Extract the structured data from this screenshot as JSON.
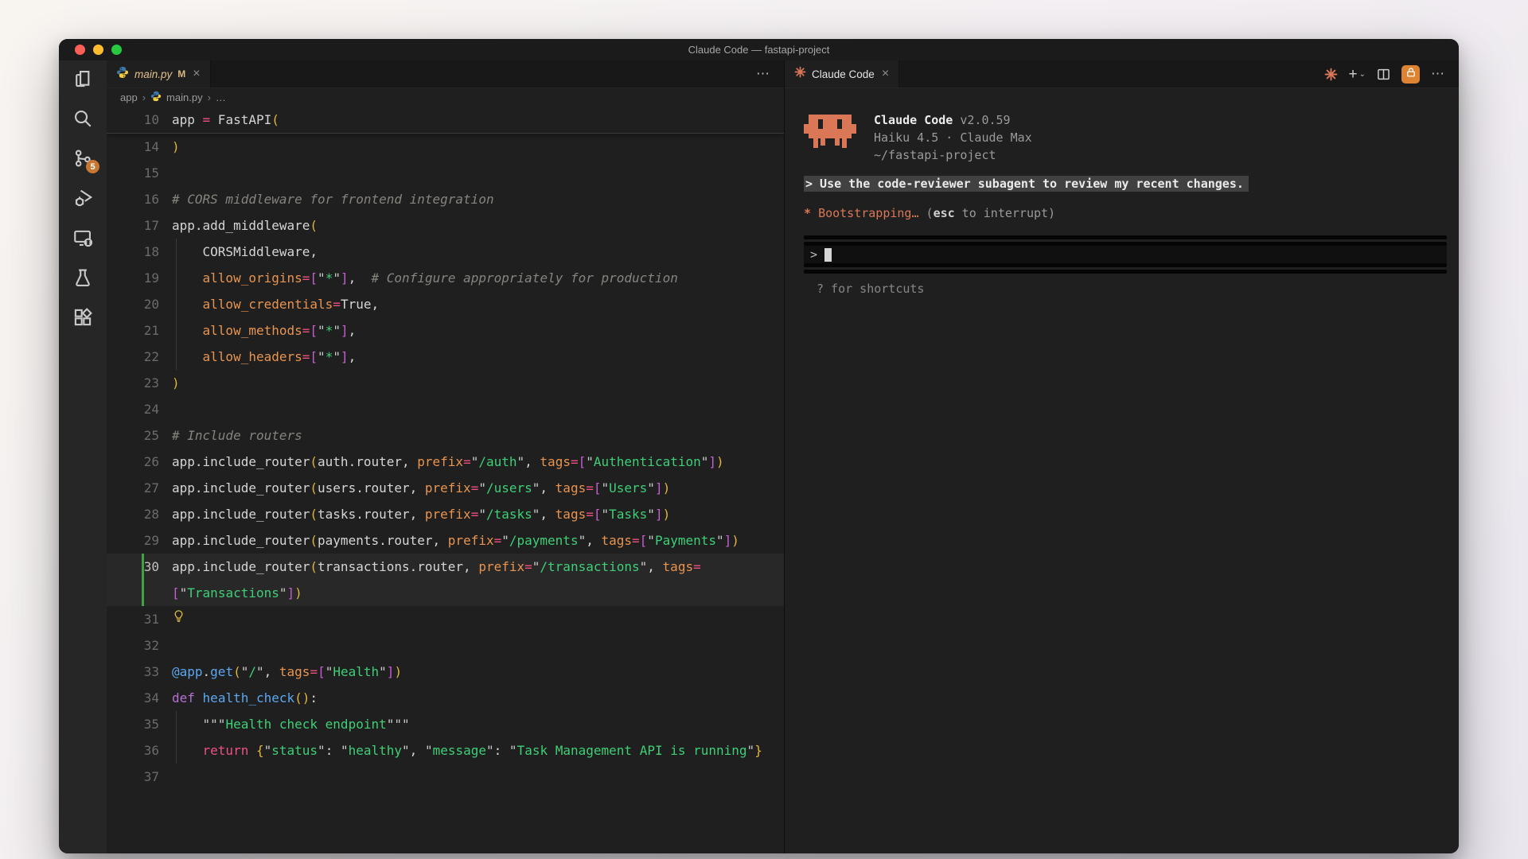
{
  "window": {
    "title": "Claude Code — fastapi-project"
  },
  "activity_bar": {
    "badge": "5",
    "items": [
      "explorer",
      "search",
      "source-control",
      "run-and-debug",
      "remote-explorer",
      "testing",
      "extensions"
    ]
  },
  "left_editor": {
    "tab": {
      "label": "main.py",
      "modified": "M",
      "close": "×"
    },
    "actions_icon": "⋯",
    "breadcrumb": {
      "items": [
        "app",
        "main.py",
        "…"
      ],
      "separator": "›"
    },
    "sticky": {
      "num": "10",
      "tokens": [
        [
          "app ",
          "p"
        ],
        [
          "=",
          "k"
        ],
        [
          " FastAPI",
          "p"
        ],
        [
          "(",
          "b1"
        ]
      ]
    },
    "lines": [
      {
        "num": "14",
        "tokens": [
          [
            ")",
            "b1"
          ]
        ]
      },
      {
        "num": "15",
        "tokens": []
      },
      {
        "num": "16",
        "tokens": [
          [
            "# CORS middleware for frontend integration",
            "c"
          ]
        ]
      },
      {
        "num": "17",
        "tokens": [
          [
            "app.add_middleware",
            "p"
          ],
          [
            "(",
            "b1"
          ]
        ]
      },
      {
        "num": "18",
        "flags": [
          "ig"
        ],
        "tokens": [
          [
            "    CORSMiddleware,",
            "p"
          ]
        ]
      },
      {
        "num": "19",
        "flags": [
          "ig"
        ],
        "tokens": [
          [
            "    ",
            "p"
          ],
          [
            "allow_origins",
            "prm"
          ],
          [
            "=",
            "k"
          ],
          [
            "[",
            "b2"
          ],
          [
            "\"",
            "q"
          ],
          [
            "*",
            "s"
          ],
          [
            "\"",
            "q"
          ],
          [
            "]",
            "b2"
          ],
          [
            ",",
            "p"
          ],
          [
            "  ",
            "p"
          ],
          [
            "# Configure appropriately for production",
            "c"
          ]
        ]
      },
      {
        "num": "20",
        "flags": [
          "ig"
        ],
        "tokens": [
          [
            "    ",
            "p"
          ],
          [
            "allow_credentials",
            "prm"
          ],
          [
            "=",
            "k"
          ],
          [
            "True,",
            "p"
          ]
        ]
      },
      {
        "num": "21",
        "flags": [
          "ig"
        ],
        "tokens": [
          [
            "    ",
            "p"
          ],
          [
            "allow_methods",
            "prm"
          ],
          [
            "=",
            "k"
          ],
          [
            "[",
            "b2"
          ],
          [
            "\"",
            "q"
          ],
          [
            "*",
            "s"
          ],
          [
            "\"",
            "q"
          ],
          [
            "]",
            "b2"
          ],
          [
            ",",
            "p"
          ]
        ]
      },
      {
        "num": "22",
        "flags": [
          "ig"
        ],
        "tokens": [
          [
            "    ",
            "p"
          ],
          [
            "allow_headers",
            "prm"
          ],
          [
            "=",
            "k"
          ],
          [
            "[",
            "b2"
          ],
          [
            "\"",
            "q"
          ],
          [
            "*",
            "s"
          ],
          [
            "\"",
            "q"
          ],
          [
            "]",
            "b2"
          ],
          [
            ",",
            "p"
          ]
        ]
      },
      {
        "num": "23",
        "tokens": [
          [
            ")",
            "b1"
          ]
        ]
      },
      {
        "num": "24",
        "tokens": []
      },
      {
        "num": "25",
        "tokens": [
          [
            "# Include routers",
            "c"
          ]
        ]
      },
      {
        "num": "26",
        "tokens": [
          [
            "app.include_router",
            "p"
          ],
          [
            "(",
            "b1"
          ],
          [
            "auth.router, ",
            "p"
          ],
          [
            "prefix",
            "prm"
          ],
          [
            "=",
            "k"
          ],
          [
            "\"",
            "q"
          ],
          [
            "/auth",
            "s"
          ],
          [
            "\"",
            "q"
          ],
          [
            ", ",
            "p"
          ],
          [
            "tags",
            "prm"
          ],
          [
            "=",
            "k"
          ],
          [
            "[",
            "b2"
          ],
          [
            "\"",
            "q"
          ],
          [
            "Authentication",
            "s"
          ],
          [
            "\"",
            "q"
          ],
          [
            "]",
            "b2"
          ],
          [
            ")",
            "b1"
          ]
        ]
      },
      {
        "num": "27",
        "tokens": [
          [
            "app.include_router",
            "p"
          ],
          [
            "(",
            "b1"
          ],
          [
            "users.router, ",
            "p"
          ],
          [
            "prefix",
            "prm"
          ],
          [
            "=",
            "k"
          ],
          [
            "\"",
            "q"
          ],
          [
            "/users",
            "s"
          ],
          [
            "\"",
            "q"
          ],
          [
            ", ",
            "p"
          ],
          [
            "tags",
            "prm"
          ],
          [
            "=",
            "k"
          ],
          [
            "[",
            "b2"
          ],
          [
            "\"",
            "q"
          ],
          [
            "Users",
            "s"
          ],
          [
            "\"",
            "q"
          ],
          [
            "]",
            "b2"
          ],
          [
            ")",
            "b1"
          ]
        ]
      },
      {
        "num": "28",
        "tokens": [
          [
            "app.include_router",
            "p"
          ],
          [
            "(",
            "b1"
          ],
          [
            "tasks.router, ",
            "p"
          ],
          [
            "prefix",
            "prm"
          ],
          [
            "=",
            "k"
          ],
          [
            "\"",
            "q"
          ],
          [
            "/tasks",
            "s"
          ],
          [
            "\"",
            "q"
          ],
          [
            ", ",
            "p"
          ],
          [
            "tags",
            "prm"
          ],
          [
            "=",
            "k"
          ],
          [
            "[",
            "b2"
          ],
          [
            "\"",
            "q"
          ],
          [
            "Tasks",
            "s"
          ],
          [
            "\"",
            "q"
          ],
          [
            "]",
            "b2"
          ],
          [
            ")",
            "b1"
          ]
        ]
      },
      {
        "num": "29",
        "tokens": [
          [
            "app.include_router",
            "p"
          ],
          [
            "(",
            "b1"
          ],
          [
            "payments.router, ",
            "p"
          ],
          [
            "prefix",
            "prm"
          ],
          [
            "=",
            "k"
          ],
          [
            "\"",
            "q"
          ],
          [
            "/payments",
            "s"
          ],
          [
            "\"",
            "q"
          ],
          [
            ", ",
            "p"
          ],
          [
            "tags",
            "prm"
          ],
          [
            "=",
            "k"
          ],
          [
            "[",
            "b2"
          ],
          [
            "\"",
            "q"
          ],
          [
            "Payments",
            "s"
          ],
          [
            "\"",
            "q"
          ],
          [
            "]",
            "b2"
          ],
          [
            ")",
            "b1"
          ]
        ]
      },
      {
        "num": "30",
        "flags": [
          "current",
          "changed"
        ],
        "tokens": [
          [
            "app.include_router",
            "p"
          ],
          [
            "(",
            "b1"
          ],
          [
            "transactions.router, ",
            "p"
          ],
          [
            "prefix",
            "prm"
          ],
          [
            "=",
            "k"
          ],
          [
            "\"",
            "q"
          ],
          [
            "/transactions",
            "s"
          ],
          [
            "\"",
            "q"
          ],
          [
            ", ",
            "p"
          ],
          [
            "tags",
            "prm"
          ],
          [
            "=",
            "k"
          ]
        ]
      },
      {
        "num": "",
        "flags": [
          "current",
          "changed"
        ],
        "tokens": [
          [
            "[",
            "b2"
          ],
          [
            "\"",
            "q"
          ],
          [
            "Transactions",
            "s"
          ],
          [
            "\"",
            "q"
          ],
          [
            "]",
            "b2"
          ],
          [
            ")",
            "b1"
          ]
        ]
      },
      {
        "num": "31",
        "flags": [
          "bulb"
        ],
        "tokens": []
      },
      {
        "num": "32",
        "tokens": []
      },
      {
        "num": "33",
        "tokens": [
          [
            "@app",
            "fn"
          ],
          [
            ".",
            "p"
          ],
          [
            "get",
            "fn"
          ],
          [
            "(",
            "b1"
          ],
          [
            "\"",
            "q"
          ],
          [
            "/",
            "s"
          ],
          [
            "\"",
            "q"
          ],
          [
            ", ",
            "p"
          ],
          [
            "tags",
            "prm"
          ],
          [
            "=",
            "k"
          ],
          [
            "[",
            "b2"
          ],
          [
            "\"",
            "q"
          ],
          [
            "Health",
            "s"
          ],
          [
            "\"",
            "q"
          ],
          [
            "]",
            "b2"
          ],
          [
            ")",
            "b1"
          ]
        ]
      },
      {
        "num": "34",
        "tokens": [
          [
            "def",
            "d"
          ],
          [
            " ",
            "p"
          ],
          [
            "health_check",
            "fn"
          ],
          [
            "(",
            "b1"
          ],
          [
            ")",
            "b1"
          ],
          [
            ":",
            "p"
          ]
        ]
      },
      {
        "num": "35",
        "flags": [
          "ig"
        ],
        "tokens": [
          [
            "    ",
            "p"
          ],
          [
            "\"\"\"",
            "q"
          ],
          [
            "Health check endpoint",
            "s"
          ],
          [
            "\"\"\"",
            "q"
          ]
        ]
      },
      {
        "num": "36",
        "flags": [
          "ig"
        ],
        "tokens": [
          [
            "    ",
            "p"
          ],
          [
            "return",
            "k"
          ],
          [
            " ",
            "p"
          ],
          [
            "{",
            "b1"
          ],
          [
            "\"",
            "q"
          ],
          [
            "status",
            "s"
          ],
          [
            "\"",
            "q"
          ],
          [
            ": ",
            "p"
          ],
          [
            "\"",
            "q"
          ],
          [
            "healthy",
            "s"
          ],
          [
            "\"",
            "q"
          ],
          [
            ", ",
            "p"
          ],
          [
            "\"",
            "q"
          ],
          [
            "message",
            "s"
          ],
          [
            "\"",
            "q"
          ],
          [
            ": ",
            "p"
          ],
          [
            "\"",
            "q"
          ],
          [
            "Task Management API is running",
            "s"
          ],
          [
            "\"",
            "q"
          ],
          [
            "}",
            "b1"
          ]
        ]
      },
      {
        "num": "37",
        "tokens": []
      }
    ]
  },
  "right_editor": {
    "tab": {
      "label": "Claude Code",
      "close": "×"
    },
    "toolbar": {
      "plus": "+",
      "chevron": "⌄",
      "dots": "⋯"
    },
    "header": {
      "name": "Claude Code",
      "version": "v2.0.59",
      "model_line": "Haiku 4.5 · Claude Max",
      "cwd": "~/fastapi-project"
    },
    "user_message": "> Use the code-reviewer subagent to review my recent changes.",
    "status": {
      "spark": "*",
      "label": "Bootstrapping…",
      "hint_open": "(",
      "hint_key": "esc",
      "hint_rest": " to interrupt)"
    },
    "input": {
      "prompt": ">"
    },
    "footer_hint": "? for shortcuts"
  },
  "colors": {
    "accent_orange": "#d97757",
    "modified_gold": "#e2c08d",
    "badge_orange": "#c87732",
    "change_green": "#43a047",
    "traffic_red": "#ff5f57",
    "traffic_yellow": "#febc2e",
    "traffic_green": "#28c840"
  }
}
